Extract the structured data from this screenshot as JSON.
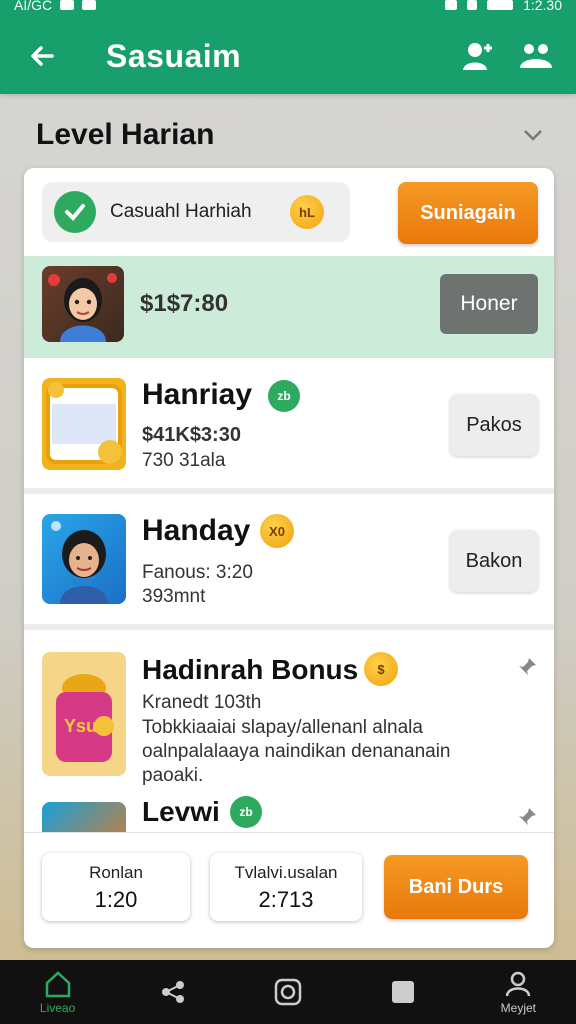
{
  "statusbar": {
    "left_text": "AI/GC",
    "time": "1:2.30"
  },
  "appbar": {
    "title": "Sasuaim"
  },
  "section": {
    "title": "Level Harian"
  },
  "checkin": {
    "label": "Casuahl Harhiah",
    "coin_label": "hL",
    "button": "Suniagain"
  },
  "rows": [
    {
      "amount": "$1$7:80",
      "button": "Honer"
    },
    {
      "title": "Hanriay",
      "badge": "zb",
      "amount": "$41K$3:30",
      "sub": "730 31ala",
      "button": "Pakos"
    },
    {
      "title": "Handay",
      "badge": "X0",
      "sub1": "Fanous: 3:20",
      "sub2": "393mnt",
      "button": "Bakon"
    },
    {
      "title": "Hadinrah Bonus",
      "badge": "$",
      "sub1": "Kranedt 103th",
      "desc": "Tobkkiaaiai slapay/allenanl alnala oalnpalalaaya naindikan denananain paoaki.",
      "sticker": "Ysu"
    },
    {
      "title": "Levwi",
      "badge": "zb"
    }
  ],
  "footer": {
    "stat1": {
      "label": "Ronlan",
      "value": "1:20"
    },
    "stat2": {
      "label": "Tvlalvi.usalan",
      "value": "2:713"
    },
    "button": "Bani Durs"
  },
  "bottomnav": [
    {
      "label": "Liveao",
      "icon": "home-icon"
    },
    {
      "label": "",
      "icon": "share-icon"
    },
    {
      "label": "",
      "icon": "camera-icon"
    },
    {
      "label": "",
      "icon": "square-icon"
    },
    {
      "label": "Meyjet",
      "icon": "profile-icon"
    }
  ],
  "colors": {
    "primary": "#17a06b",
    "accent": "#e9780b",
    "highlight": "#cdebd9"
  }
}
